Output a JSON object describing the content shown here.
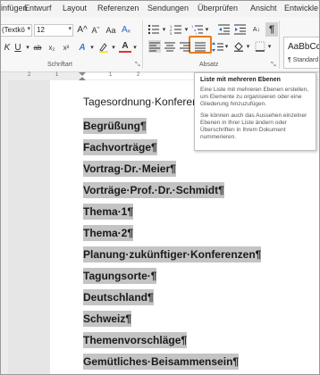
{
  "tabs": [
    "Einfügen",
    "Entwurf",
    "Layout",
    "Referenzen",
    "Sendungen",
    "Überprüfen",
    "Ansicht",
    "Entwickle"
  ],
  "ribbon": {
    "font_name": "(Textkö",
    "font_size": "12",
    "grow_font": "A^",
    "shrink_font": "Aˇ",
    "clear_format": "Aₓ",
    "italic": "K",
    "underline": "U",
    "strike": "ab",
    "sub": "x₂",
    "sup": "x²",
    "text_effects": "A",
    "font_color": "A",
    "group_font": "Schriftart",
    "group_paragraph": "Absatz",
    "show_marks": "¶",
    "style_sample": "AaBbCc",
    "style_name": "¶ Standard"
  },
  "ruler": {
    "numbers": [
      "2",
      "1",
      "1",
      "2"
    ]
  },
  "document": {
    "title": "Tagesordnung·Konferenz",
    "lines": [
      "Begrüßung¶",
      "Fachvorträge¶",
      "Vortrag·Dr.·Meier¶",
      "Vorträge·Prof.·Dr.·Schmidt¶",
      "Thema·1¶",
      "Thema·2¶",
      "Planung·zukünftiger·Konferenzen¶",
      "Tagungsorte·¶",
      "Deutschland¶",
      "Schweiz¶",
      "Themenvorschläge¶",
      "Gemütliches·Beisammensein¶"
    ]
  },
  "tooltip": {
    "title": "Liste mit mehreren Ebenen",
    "p1": "Eine Liste mit mehreren Ebenen erstellen, um Elemente zu organisieren oder eine Gliederung hinzuzufügen.",
    "p2": "Sie können auch das Aussehen einzelner Ebenen in Ihrer Liste ändern oder Überschriften in Ihrem Dokument nummerieren."
  },
  "colors": {
    "accent_highlight": "#ea7a18",
    "text_selection": "#c4c4c4",
    "font_color_bar": "#e03030",
    "highlight_bar": "#f0e020"
  }
}
